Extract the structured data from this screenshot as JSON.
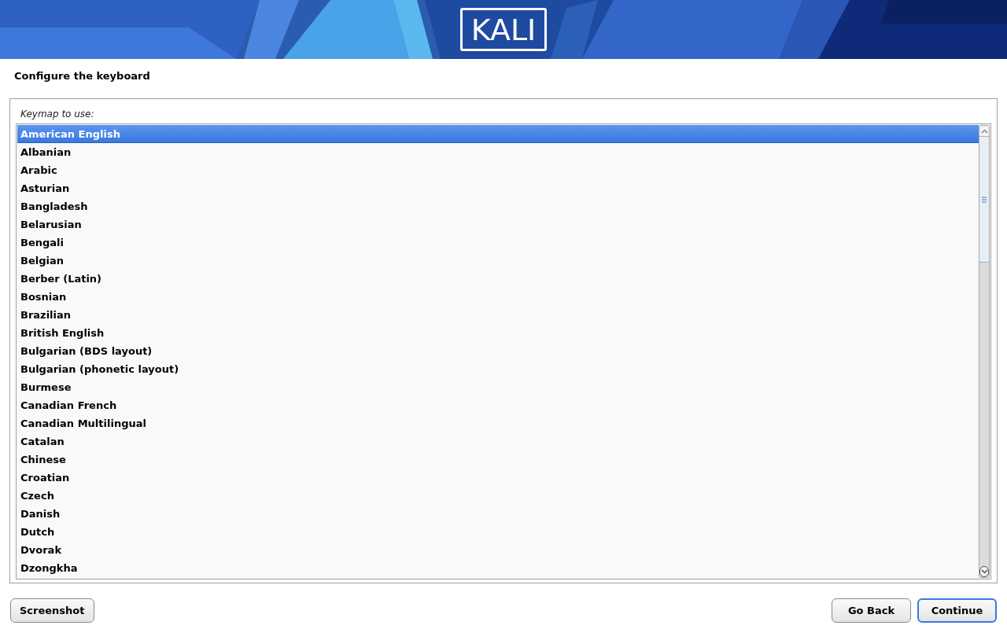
{
  "banner": {
    "logo": "KALI"
  },
  "title": "Configure the keyboard",
  "prompt": "Keymap to use:",
  "keymaps": [
    {
      "label": "American English",
      "selected": true
    },
    {
      "label": "Albanian",
      "selected": false
    },
    {
      "label": "Arabic",
      "selected": false
    },
    {
      "label": "Asturian",
      "selected": false
    },
    {
      "label": "Bangladesh",
      "selected": false
    },
    {
      "label": "Belarusian",
      "selected": false
    },
    {
      "label": "Bengali",
      "selected": false
    },
    {
      "label": "Belgian",
      "selected": false
    },
    {
      "label": "Berber (Latin)",
      "selected": false
    },
    {
      "label": "Bosnian",
      "selected": false
    },
    {
      "label": "Brazilian",
      "selected": false
    },
    {
      "label": "British English",
      "selected": false
    },
    {
      "label": "Bulgarian (BDS layout)",
      "selected": false
    },
    {
      "label": "Bulgarian (phonetic layout)",
      "selected": false
    },
    {
      "label": "Burmese",
      "selected": false
    },
    {
      "label": "Canadian French",
      "selected": false
    },
    {
      "label": "Canadian Multilingual",
      "selected": false
    },
    {
      "label": "Catalan",
      "selected": false
    },
    {
      "label": "Chinese",
      "selected": false
    },
    {
      "label": "Croatian",
      "selected": false
    },
    {
      "label": "Czech",
      "selected": false
    },
    {
      "label": "Danish",
      "selected": false
    },
    {
      "label": "Dutch",
      "selected": false
    },
    {
      "label": "Dvorak",
      "selected": false
    },
    {
      "label": "Dzongkha",
      "selected": false
    }
  ],
  "buttons": {
    "left": [
      "Screenshot"
    ],
    "right": [
      {
        "label": "Go Back",
        "focused": false
      },
      {
        "label": "Continue",
        "focused": true
      }
    ]
  }
}
